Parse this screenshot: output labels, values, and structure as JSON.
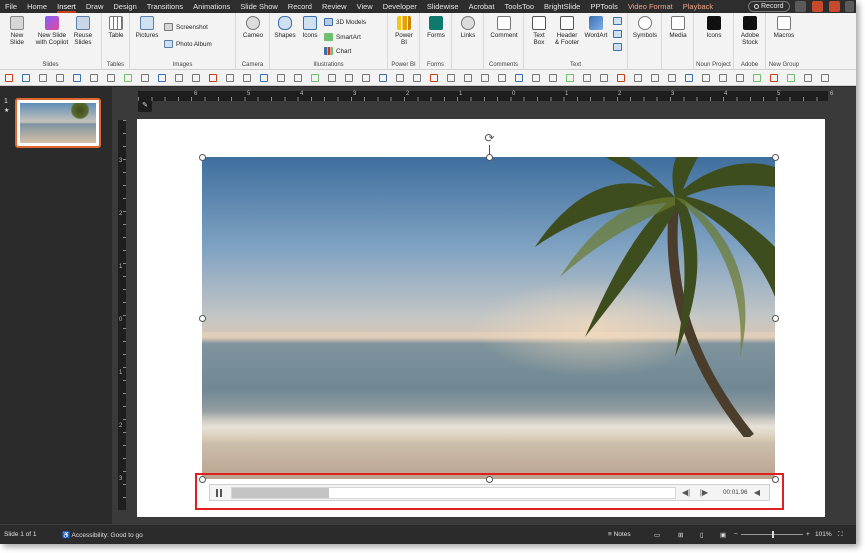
{
  "menu": {
    "tabs": [
      "File",
      "Home",
      "Insert",
      "Draw",
      "Design",
      "Transitions",
      "Animations",
      "Slide Show",
      "Record",
      "Review",
      "View",
      "Developer",
      "Slidewise",
      "Acrobat",
      "ToolsToo",
      "BrightSlide",
      "PPTools",
      "Video Format",
      "Playback"
    ],
    "active_tab": "Insert",
    "record_label": "Record"
  },
  "ribbon": {
    "groups": {
      "slides": "Slides",
      "tables": "Tables",
      "images": "Images",
      "camera": "Camera",
      "illustrations": "Illustrations",
      "powerbi": "Power BI",
      "forms": "Forms",
      "comments": "Comments",
      "text": "Text",
      "noun": "Noun Project",
      "adobe": "Adobe",
      "newgroup": "New Group"
    },
    "buttons": {
      "new_slide": "New\nSlide",
      "new_slide_copilot": "New Slide\nwith Copilot",
      "reuse_slides": "Reuse\nSlides",
      "table": "Table",
      "pictures": "Pictures",
      "screenshot": "Screenshot",
      "photo_album": "Photo Album",
      "cameo": "Cameo",
      "shapes": "Shapes",
      "icons": "Icons",
      "models": "3D Models",
      "smartart": "SmartArt",
      "chart": "Chart",
      "powerbi": "Power\nBI",
      "forms": "Forms",
      "links": "Links",
      "comment": "Comment",
      "textbox": "Text\nBox",
      "header_footer": "Header\n& Footer",
      "wordart": "WordArt",
      "symbols": "Symbols",
      "media": "Media",
      "noun_icons": "Icons",
      "adobe_stock": "Adobe\nStock",
      "macros": "Macros"
    }
  },
  "thumbnails": {
    "slide_number": "1",
    "star": "★"
  },
  "ruler": {
    "h_labels": [
      "6",
      "5",
      "4",
      "3",
      "2",
      "1",
      "0",
      "1",
      "2",
      "3",
      "4",
      "5",
      "6"
    ],
    "v_labels": [
      "3",
      "2",
      "1",
      "0",
      "1",
      "2",
      "3"
    ]
  },
  "video_player": {
    "time": "00:01.96",
    "progress": 0.22,
    "state": "playing"
  },
  "status": {
    "slide_info": "Slide 1 of 1",
    "accessibility": "Accessibility: Good to go",
    "notes": "Notes",
    "zoom": "101%"
  },
  "colors": {
    "accent": "#c43e1c",
    "highlight_box": "#e02020",
    "context_tab": "#f0a58a"
  }
}
